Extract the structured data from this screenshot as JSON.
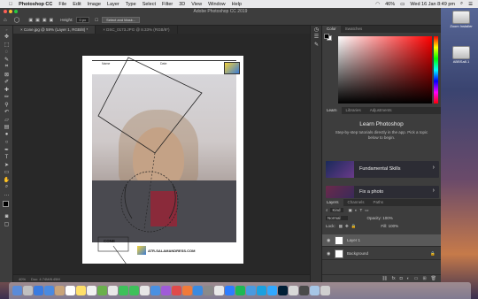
{
  "menubar": {
    "app": "Photoshop CC",
    "items": [
      "File",
      "Edit",
      "Image",
      "Layer",
      "Type",
      "Select",
      "Filter",
      "3D",
      "View",
      "Window",
      "Help"
    ],
    "battery": "46%",
    "datetime": "Wed 16 Jan  8:49 pm"
  },
  "window": {
    "title": "Adobe Photoshop CC 2019"
  },
  "options": {
    "height_label": "Height:",
    "height_value": "0 px",
    "select_mask": "Select and Mask..."
  },
  "doc_tabs": [
    {
      "label": "Cone.jpg @ 59% (Layer 1, RGB/8) *",
      "close": "×"
    },
    {
      "label": "DSC_0173.JPG @ 8.33% (RGB/8*)",
      "close": "×"
    }
  ],
  "page": {
    "name_label": "Name",
    "date_label": "Date",
    "cone_label": "CONE",
    "footer_text": "ATR-SALAMANDRESS.COM"
  },
  "status": {
    "zoom": "40%",
    "doc": "Doc: 4.74M/8.45M"
  },
  "panels": {
    "color_tabs": [
      "Color",
      "Swatches"
    ],
    "learn_tabs": [
      "Learn",
      "Libraries",
      "Adjustments"
    ],
    "learn_title": "Learn Photoshop",
    "learn_desc": "Step-by-step tutorials directly in the app. Pick a topic below to begin.",
    "learn_cards": [
      {
        "label": "Fundamental Skills",
        "chevron": "›"
      },
      {
        "label": "Fix a photo",
        "chevron": "›"
      }
    ],
    "layers_tabs": [
      "Layers",
      "Channels",
      "Paths"
    ],
    "kind": "Kind",
    "blend_mode": "Normal",
    "opacity": "Opacity: 100%",
    "lock": "Lock:",
    "fill": "Fill: 100%",
    "layers": [
      {
        "name": "Layer 1",
        "selected": true
      },
      {
        "name": "Background",
        "selected": false,
        "locked": true
      }
    ]
  },
  "desktop": {
    "drives": [
      {
        "label": "Zoom Installer"
      },
      {
        "label": "ABBSa8.1"
      }
    ]
  },
  "colors": {
    "desktop_top": "#5a6a9a",
    "ps_bg": "#323232",
    "accent": "#3c7bd6"
  }
}
